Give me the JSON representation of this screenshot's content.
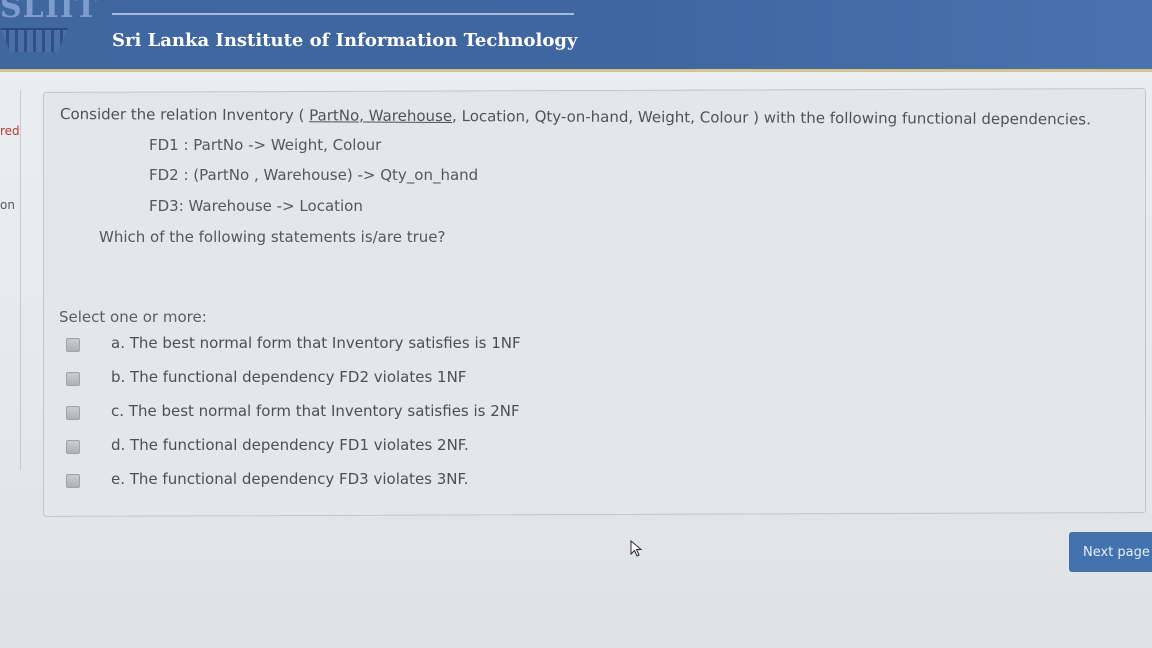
{
  "header": {
    "logo_text": "SLIIT",
    "institute_name": "Sri Lanka Institute of Information Technology"
  },
  "sidebar": {
    "fragment_top": "red",
    "fragment_bottom": "on"
  },
  "question": {
    "intro_before": "Consider the relation Inventory ( ",
    "intro_key": "PartNo, Warehouse",
    "intro_after": ", Location, Qty-on-hand, Weight, Colour ) with the following functional dependencies.",
    "fd1": "FD1 : PartNo -> Weight, Colour",
    "fd2": "FD2 : (PartNo , Warehouse)  -> Qty_on_hand",
    "fd3": "FD3:  Warehouse  -> Location",
    "prompt": "Which of the following statements is/are true?"
  },
  "answers": {
    "select_label": "Select one or more:",
    "options": [
      {
        "text": "a. The best normal form that Inventory satisfies is 1NF",
        "checked": false
      },
      {
        "text": "b. The functional dependency FD2 violates 1NF",
        "checked": false
      },
      {
        "text": "c. The best normal form that Inventory satisfies is 2NF",
        "checked": false
      },
      {
        "text": "d. The functional dependency FD1 violates 2NF.",
        "checked": false
      },
      {
        "text": "e. The functional dependency FD3 violates 3NF.",
        "checked": false
      }
    ]
  },
  "navigation": {
    "next_label": "Next page"
  },
  "colors": {
    "header_blue": "#41679f",
    "button_blue": "#4373ae",
    "sidebar_accent": "#b43a2f"
  }
}
